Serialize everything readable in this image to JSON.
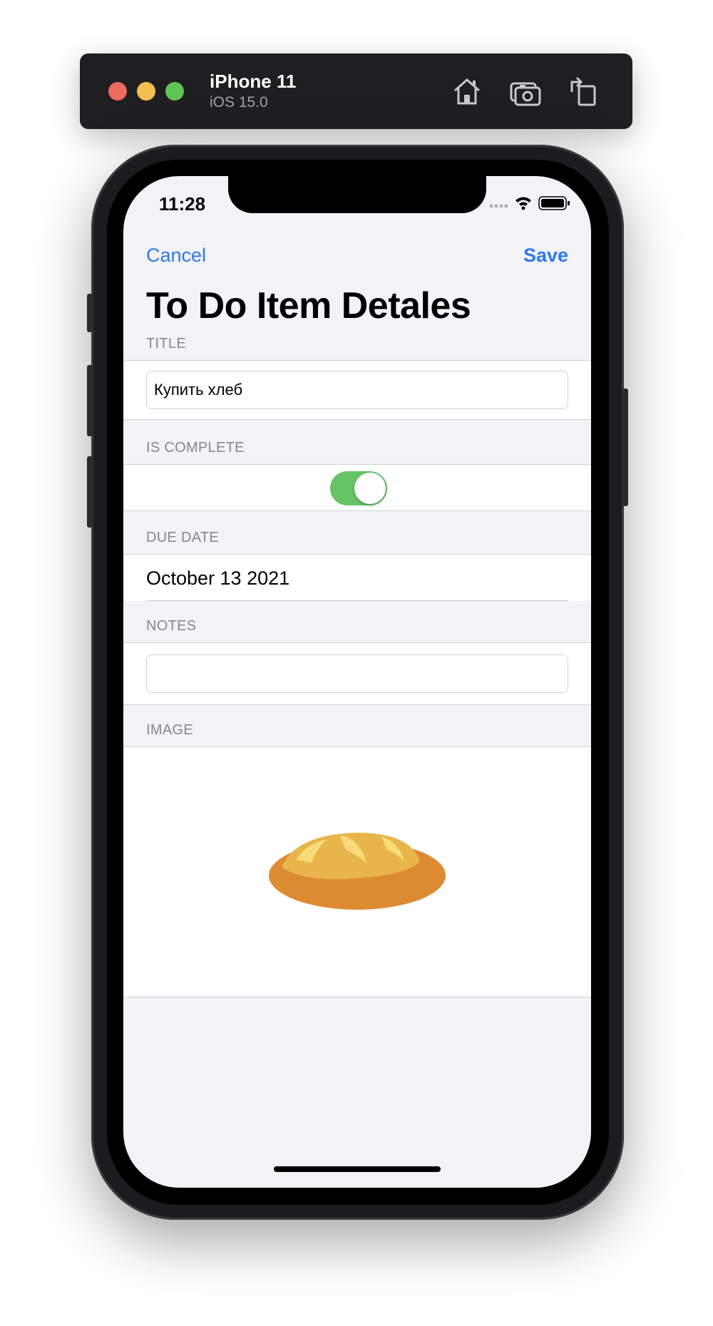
{
  "simulator": {
    "device": "iPhone 11",
    "os": "iOS 15.0",
    "buttons": [
      "home-icon",
      "screenshot-icon",
      "rotate-icon"
    ]
  },
  "status_bar": {
    "time": "11:28",
    "icons": [
      "signal-icon",
      "wifi-icon",
      "battery-icon"
    ]
  },
  "nav": {
    "cancel": "Cancel",
    "save": "Save",
    "title": "To Do Item Detales"
  },
  "sections": {
    "title": {
      "header": "TITLE",
      "value": "Купить хлеб"
    },
    "is_complete": {
      "header": "IS COMPLETE",
      "on": true
    },
    "due_date": {
      "header": "DUE DATE",
      "value": "October 13 2021"
    },
    "notes": {
      "header": "NOTES",
      "value": ""
    },
    "image": {
      "header": "IMAGE",
      "icon": "bread-icon"
    }
  },
  "colors": {
    "accent": "#2f7ae5",
    "toggle_on": "#65c466",
    "group_background": "#f2f2f7"
  }
}
